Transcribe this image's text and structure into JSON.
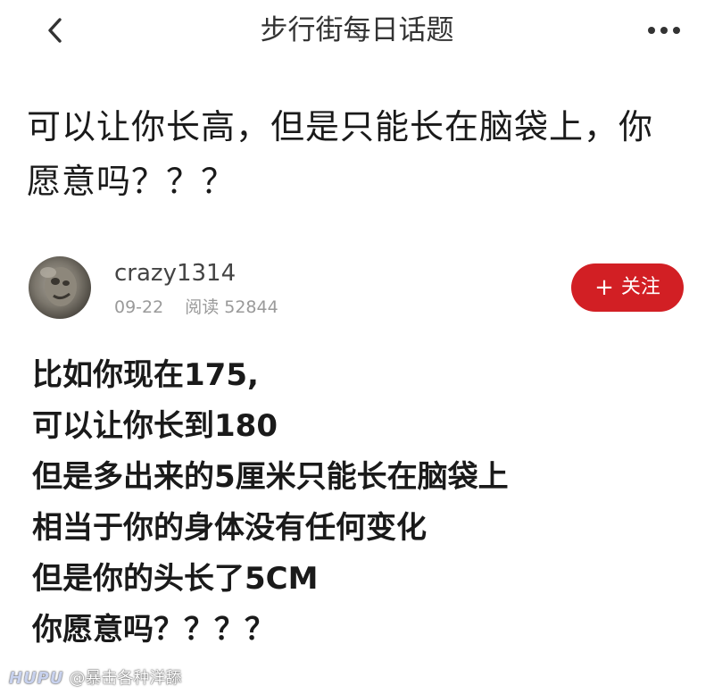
{
  "header": {
    "title": "步行街每日话题",
    "back_icon": "chevron-left-icon",
    "more_icon": "more-dots-icon"
  },
  "post": {
    "title": "可以让你长高，但是只能长在脑袋上，你愿意吗？？？",
    "author": {
      "name": "crazy1314",
      "date": "09-22",
      "reads": "阅读 52844"
    },
    "follow_label": "关注",
    "follow_color": "#d21f24",
    "body_lines": [
      "比如你现在175,",
      "可以让你长到180",
      "但是多出来的5厘米只能长在脑袋上",
      "相当于你的身体没有任何变化",
      "但是你的头长了5CM",
      "你愿意吗？？？？"
    ]
  },
  "watermark": {
    "logo": "HUPU",
    "handle": "@暴击各种洋舔"
  }
}
